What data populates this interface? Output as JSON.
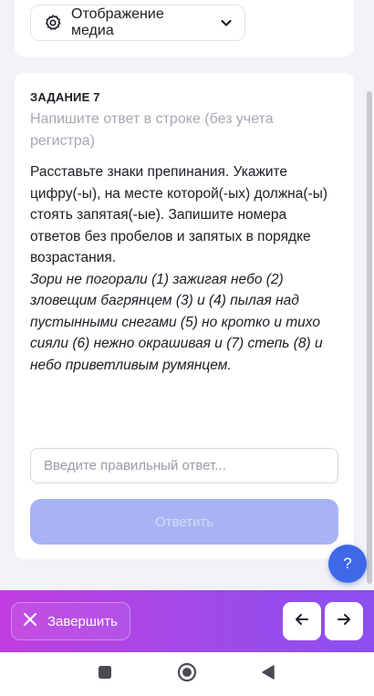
{
  "media": {
    "label": "Отображение медиа"
  },
  "task": {
    "number": "ЗАДАНИЕ 7",
    "hint": "Напишите ответ в строке (без учета регистра)",
    "instruction": "Расставьте знаки препинания. Укажите цифру(-ы), на месте которой(-ых) должна(-ы) стоять запятая(-ые). Запишите номера ответов без пробелов и запятых в порядке возрастания.",
    "sentence": "Зори не погорали (1) зажигая небо (2) зловещим багрянцем (3) и (4) пылая над пустынными снегами (5) но кротко и тихо сияли (6) нежно окрашивая и (7) степь (8) и небо приветливым румянцем."
  },
  "answer": {
    "placeholder": "Введите правильный ответ...",
    "value": "",
    "submit_label": "Ответить"
  },
  "help": {
    "label": "?"
  },
  "bottom": {
    "finish_label": "Завершить"
  },
  "colors": {
    "accent": "#3f68e8",
    "submit_disabled": "#a8b3f3",
    "gradient_start": "#c13de0",
    "gradient_end": "#8c4ff0"
  },
  "icons": {
    "media": "gear-icon",
    "media_chevron": "chevron-down-icon",
    "finish": "close-icon",
    "prev": "arrow-left-icon",
    "next": "arrow-right-icon",
    "recents": "square-icon",
    "home": "circle-icon",
    "back": "triangle-back-icon"
  }
}
